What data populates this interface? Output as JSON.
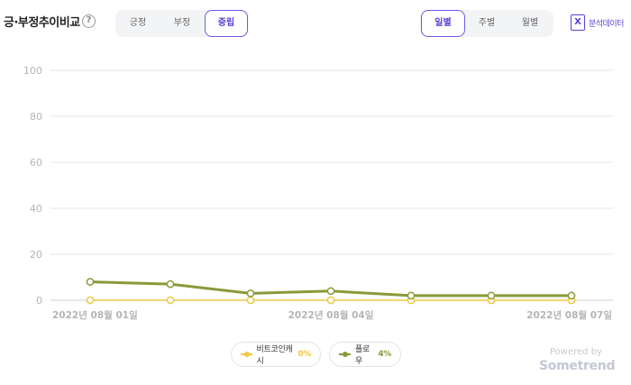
{
  "header": {
    "title": "긍·부정추이비교",
    "help_glyph": "?",
    "sentiment_tabs": [
      {
        "label": "긍정",
        "active": false
      },
      {
        "label": "부정",
        "active": false
      },
      {
        "label": "중립",
        "active": true
      }
    ],
    "period_tabs": [
      {
        "label": "일별",
        "active": true
      },
      {
        "label": "주별",
        "active": false
      },
      {
        "label": "월별",
        "active": false
      }
    ],
    "export_label": "분석데이터",
    "export_icon": "excel-icon"
  },
  "chart_data": {
    "type": "line",
    "title": "",
    "xlabel": "",
    "ylabel": "",
    "ylim": [
      0,
      100
    ],
    "yticks": [
      0,
      20,
      40,
      60,
      80,
      100
    ],
    "grid": true,
    "x": [
      "2022-08-01",
      "2022-08-02",
      "2022-08-03",
      "2022-08-04",
      "2022-08-05",
      "2022-08-06",
      "2022-08-07"
    ],
    "x_tick_labels": [
      {
        "index": 0,
        "label": "2022년 08월 01일"
      },
      {
        "index": 3,
        "label": "2022년 08월 04일"
      },
      {
        "index": 6,
        "label": "2022년 08월 07일"
      }
    ],
    "series": [
      {
        "name": "비트코인캐시",
        "color": "#f2c744",
        "values": [
          0,
          0,
          0,
          0,
          0,
          0,
          0
        ],
        "legend_pct": "0%"
      },
      {
        "name": "플로우",
        "color": "#8a9a3a",
        "values": [
          8,
          7,
          3,
          4,
          2,
          2,
          2
        ],
        "legend_pct": "4%"
      }
    ],
    "legend_placement": "bottom"
  },
  "footer": {
    "powered_by": "Powered by",
    "brand": "Sometrend"
  }
}
